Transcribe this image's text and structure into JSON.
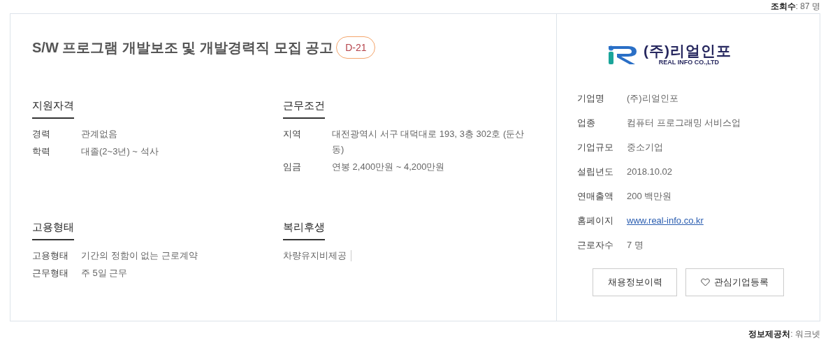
{
  "views": {
    "label": "조회수",
    "separator": ":",
    "value": "87 명"
  },
  "posting": {
    "title": "S/W 프로그램 개발보조 및 개발경력직 모집 공고",
    "badge": "D-21",
    "sections": [
      {
        "kind": "pairs",
        "heading": "지원자격",
        "rows": [
          {
            "label": "경력",
            "value": "관계없음"
          },
          {
            "label": "학력",
            "value": "대졸(2~3년) ~ 석사"
          }
        ]
      },
      {
        "kind": "pairs",
        "heading": "근무조건",
        "rows": [
          {
            "label": "지역",
            "value": "대전광역시 서구 대덕대로 193, 3층 302호 (둔산동)"
          },
          {
            "label": "임금",
            "value": "연봉 2,400만원 ~ 4,200만원"
          }
        ]
      },
      {
        "kind": "pairs",
        "heading": "고용형태",
        "rows": [
          {
            "label": "고용형태",
            "value": "기간의 정함이 없는 근로계약"
          },
          {
            "label": "근무형태",
            "value": "주 5일 근무"
          }
        ]
      },
      {
        "kind": "tags",
        "heading": "복리후생",
        "tags": [
          "차량유지비제공"
        ]
      }
    ]
  },
  "company": {
    "logo": {
      "name": "(주)리얼인포",
      "subtitle": "REAL INFO CO.,LTD"
    },
    "rows": [
      {
        "kind": "text",
        "label": "기업명",
        "value": "(주)리얼인포"
      },
      {
        "kind": "text",
        "label": "업종",
        "value": "컴퓨터 프로그래밍 서비스업"
      },
      {
        "kind": "text",
        "label": "기업규모",
        "value": "중소기업"
      },
      {
        "kind": "text",
        "label": "설립년도",
        "value": "2018.10.02"
      },
      {
        "kind": "text",
        "label": "연매출액",
        "value": "200 백만원"
      },
      {
        "kind": "link",
        "label": "홈페이지",
        "value": "www.real-info.co.kr"
      },
      {
        "kind": "text",
        "label": "근로자수",
        "value": "7 명"
      }
    ],
    "buttons": [
      {
        "kind": "plain",
        "label": "채용정보이력"
      },
      {
        "kind": "heart",
        "label": "관심기업등록"
      }
    ]
  },
  "source": {
    "label": "정보제공처",
    "separator": ":",
    "value": "워크넷"
  }
}
